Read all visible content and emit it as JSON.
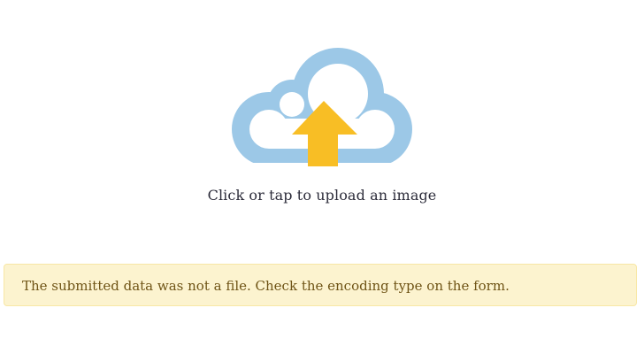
{
  "upload": {
    "label": "Click or tap to upload an image",
    "icon": "cloud-upload-icon",
    "cloud_color": "#9cc8e7",
    "arrow_color": "#f8be25"
  },
  "alert": {
    "type": "warning",
    "message": "The submitted data was not a file. Check the encoding type on the form.",
    "background": "#fcf3cf",
    "text_color": "#6f5416"
  }
}
